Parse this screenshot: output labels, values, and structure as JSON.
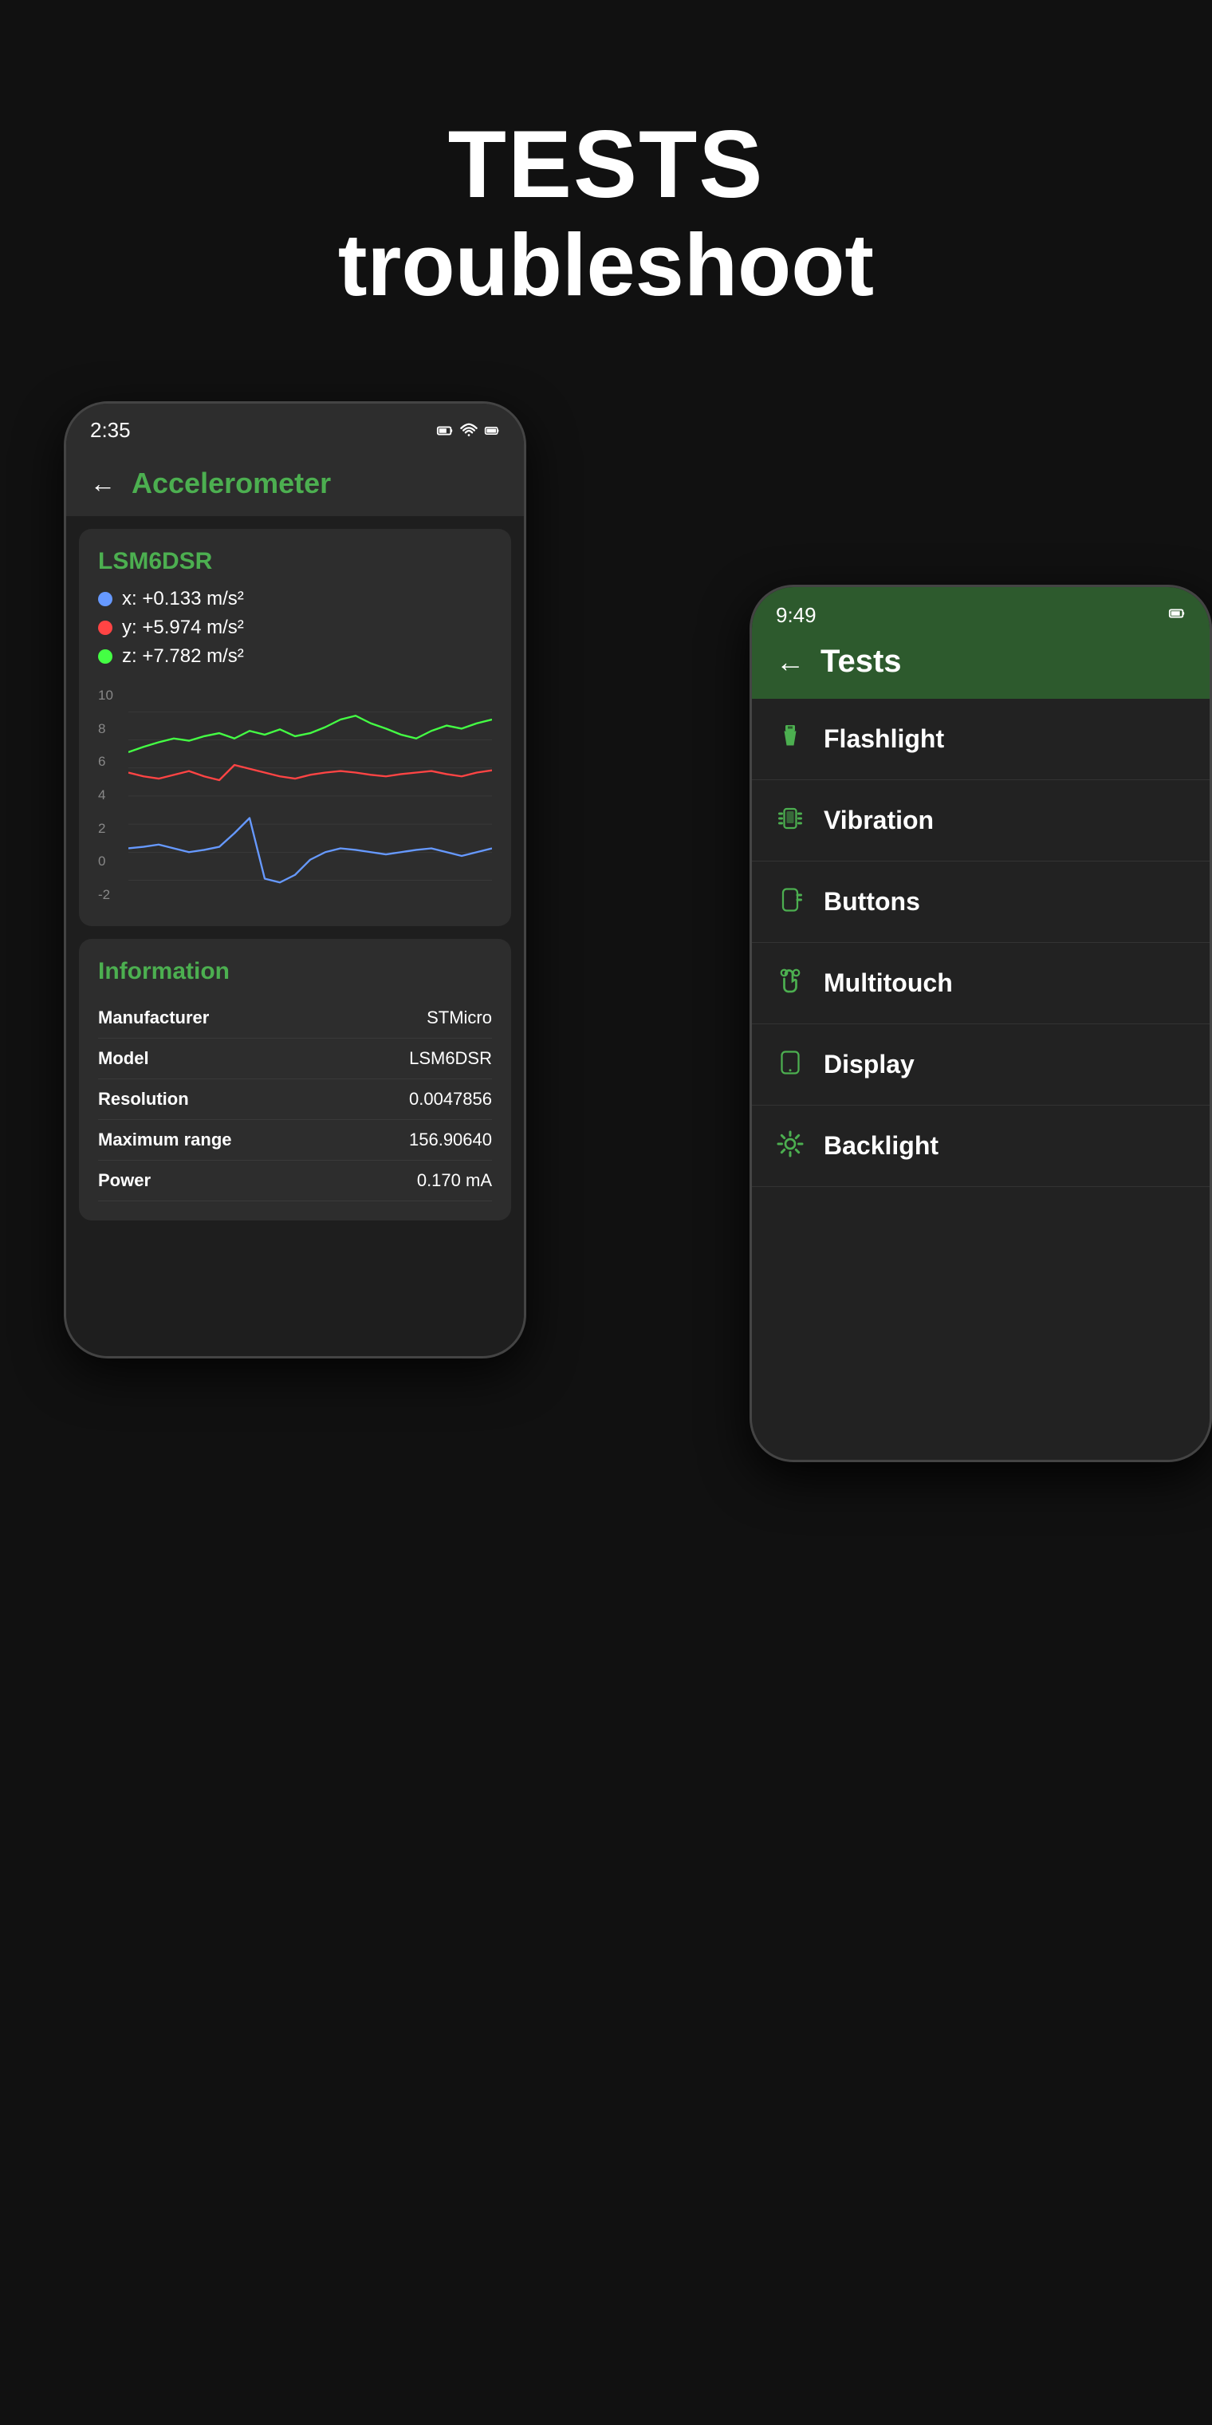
{
  "header": {
    "title": "TESTS",
    "subtitle": "troubleshoot"
  },
  "phone_left": {
    "status_bar": {
      "time": "2:35",
      "battery_icon": "🔋",
      "wifi_icon": "wifi",
      "battery2_icon": "battery"
    },
    "app_bar": {
      "back_label": "←",
      "title": "Accelerometer"
    },
    "sensor_section": {
      "title": "LSM6DSR",
      "x_label": "x: +0.133 m/s²",
      "y_label": "y: +5.974 m/s²",
      "z_label": "z: +7.782 m/s²"
    },
    "chart": {
      "y_labels": [
        "10",
        "8",
        "6",
        "4",
        "2",
        "0",
        "-2"
      ]
    },
    "info_section": {
      "title": "Information",
      "rows": [
        {
          "label": "Manufacturer",
          "value": "STMicro"
        },
        {
          "label": "Model",
          "value": "LSM6DSR"
        },
        {
          "label": "Resolution",
          "value": "0.0047856"
        },
        {
          "label": "Maximum range",
          "value": "156.90640"
        },
        {
          "label": "Power",
          "value": "0.170 mA"
        }
      ]
    }
  },
  "phone_right": {
    "status_bar": {
      "time": "9:49",
      "battery_icon": "🔋"
    },
    "app_bar": {
      "back_label": "←",
      "title": "Tests"
    },
    "test_items": [
      {
        "id": "flashlight",
        "name": "Flashlight"
      },
      {
        "id": "vibration",
        "name": "Vibration"
      },
      {
        "id": "buttons",
        "name": "Buttons"
      },
      {
        "id": "multitouch",
        "name": "Multitouch"
      },
      {
        "id": "display",
        "name": "Display"
      },
      {
        "id": "backlight",
        "name": "Backlight"
      }
    ]
  },
  "colors": {
    "green": "#4CAF50",
    "dark_bg": "#111111",
    "phone_bg": "#222222",
    "card_bg": "#2d2d2d",
    "green_header": "#2d5a2d"
  }
}
